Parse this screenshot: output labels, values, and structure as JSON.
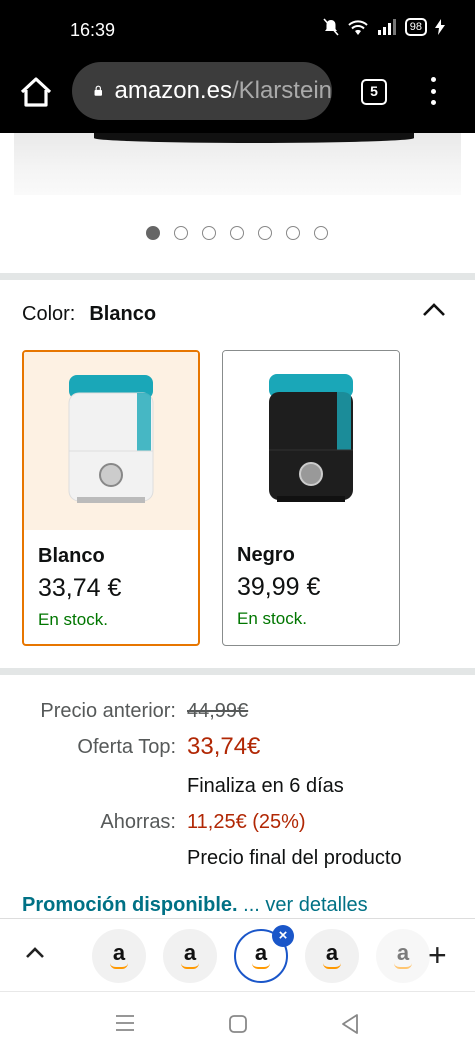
{
  "status_bar": {
    "time": "16:39",
    "battery": "98"
  },
  "browser": {
    "url_domain": "amazon.es",
    "url_path": "/Klarstein",
    "tab_count": "5"
  },
  "gallery": {
    "image_count": 7,
    "active_index": 0
  },
  "variation": {
    "label": "Color:",
    "selected_value": "Blanco",
    "options": [
      {
        "name": "Blanco",
        "price": "33,74 €",
        "stock": "En stock.",
        "body_color": "#f2f2f2",
        "bg_color": "#fdf1e3"
      },
      {
        "name": "Negro",
        "price": "39,99 €",
        "stock": "En stock.",
        "body_color": "#1e1e1e",
        "bg_color": "#ffffff"
      }
    ]
  },
  "pricing": {
    "previous_label": "Precio anterior:",
    "previous_value": "44,99€",
    "deal_label": "Oferta Top:",
    "deal_value": "33,74€",
    "deal_note": "Finaliza en 6 días",
    "savings_label": "Ahorras:",
    "savings_value": "11,25€ (25%)",
    "final_note": "Precio final del producto"
  },
  "promo": {
    "bold": "Promoción disponible.",
    "link": " ... ver detalles"
  },
  "tab_strip": {
    "tab_labels": [
      "a",
      "a",
      "a",
      "a",
      "a"
    ],
    "active_tab": 2
  },
  "colors": {
    "accent_orange": "#e77600",
    "stock_green": "#007600",
    "price_red": "#b12704",
    "link_teal": "#007185",
    "tab_active_blue": "#1a56c9"
  }
}
